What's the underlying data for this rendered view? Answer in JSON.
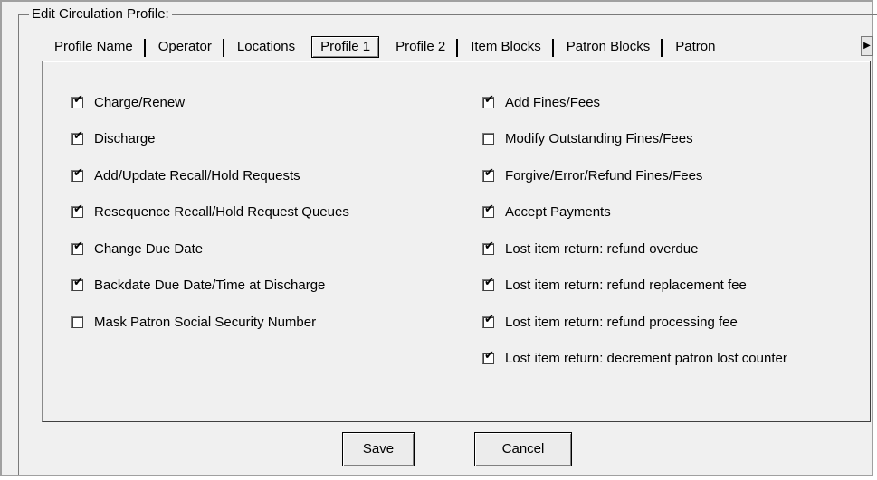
{
  "group_title": "Edit Circulation Profile:",
  "tabs": [
    {
      "label": "Profile Name",
      "active": false
    },
    {
      "label": "Operator",
      "active": false
    },
    {
      "label": "Locations",
      "active": false
    },
    {
      "label": "Profile 1",
      "active": true
    },
    {
      "label": "Profile 2",
      "active": false
    },
    {
      "label": "Item Blocks",
      "active": false
    },
    {
      "label": "Patron Blocks",
      "active": false
    },
    {
      "label": "Patron",
      "active": false
    }
  ],
  "left_options": [
    {
      "label": "Charge/Renew",
      "checked": true
    },
    {
      "label": "Discharge",
      "checked": true
    },
    {
      "label": "Add/Update Recall/Hold Requests",
      "checked": true
    },
    {
      "label": "Resequence Recall/Hold Request Queues",
      "checked": true
    },
    {
      "label": "Change Due Date",
      "checked": true
    },
    {
      "label": "Backdate Due Date/Time at Discharge",
      "checked": true
    },
    {
      "label": "Mask Patron Social Security Number",
      "checked": false
    }
  ],
  "right_options": [
    {
      "label": "Add Fines/Fees",
      "checked": true
    },
    {
      "label": "Modify Outstanding Fines/Fees",
      "checked": false
    },
    {
      "label": "Forgive/Error/Refund Fines/Fees",
      "checked": true
    },
    {
      "label": "Accept Payments",
      "checked": true
    },
    {
      "label": "Lost item return: refund overdue",
      "checked": true
    },
    {
      "label": "Lost item return: refund replacement fee",
      "checked": true
    },
    {
      "label": "Lost item return: refund processing fee",
      "checked": true
    },
    {
      "label": "Lost item return: decrement patron lost counter",
      "checked": true
    }
  ],
  "buttons": {
    "save": "Save",
    "cancel": "Cancel"
  },
  "icons": {
    "check": "✔",
    "scroll_right": "▶"
  }
}
